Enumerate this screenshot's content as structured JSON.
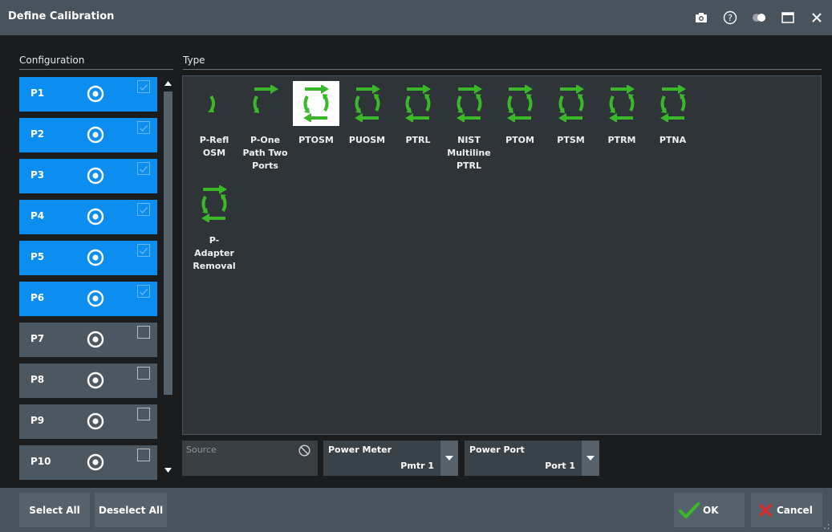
{
  "window": {
    "title": "Define Calibration",
    "icons": [
      "camera-icon",
      "help-icon",
      "toggle-icon",
      "maximize-icon",
      "close-icon"
    ]
  },
  "configuration": {
    "label": "Configuration",
    "ports": [
      {
        "label": "P1",
        "checked": true
      },
      {
        "label": "P2",
        "checked": true
      },
      {
        "label": "P3",
        "checked": true
      },
      {
        "label": "P4",
        "checked": true
      },
      {
        "label": "P5",
        "checked": true
      },
      {
        "label": "P6",
        "checked": true
      },
      {
        "label": "P7",
        "checked": false
      },
      {
        "label": "P8",
        "checked": false
      },
      {
        "label": "P9",
        "checked": false
      },
      {
        "label": "P10",
        "checked": false
      }
    ]
  },
  "type": {
    "label": "Type",
    "items": [
      {
        "label": "P-Refl\nOSM",
        "icon": "one-port-reflection-icon"
      },
      {
        "label": "P-One\nPath Two\nPorts",
        "icon": "one-path-two-port-icon"
      },
      {
        "label": "PTOSM",
        "icon": "two-port-icon",
        "selected": true
      },
      {
        "label": "PUOSM",
        "icon": "two-port-icon"
      },
      {
        "label": "PTRL",
        "icon": "two-port-icon"
      },
      {
        "label": "NIST\nMultiline\nPTRL",
        "icon": "two-port-icon"
      },
      {
        "label": "PTOM",
        "icon": "two-port-icon"
      },
      {
        "label": "PTSM",
        "icon": "two-port-icon"
      },
      {
        "label": "PTRM",
        "icon": "two-port-icon"
      },
      {
        "label": "PTNA",
        "icon": "two-port-icon"
      },
      {
        "label": "P-\nAdapter\nRemoval",
        "icon": "two-port-icon"
      }
    ]
  },
  "fields": {
    "source_placeholder": "Source",
    "power_meter_label": "Power Meter",
    "power_meter_value": "Pmtr 1",
    "power_port_label": "Power Port",
    "power_port_value": "Port 1"
  },
  "buttons": {
    "select_all": "Select All",
    "deselect_all": "Deselect All",
    "ok": "OK",
    "cancel": "Cancel"
  },
  "colors": {
    "accent": "#0c8df0",
    "icon_green": "#3bb72a",
    "cancel_red": "#e02626"
  }
}
